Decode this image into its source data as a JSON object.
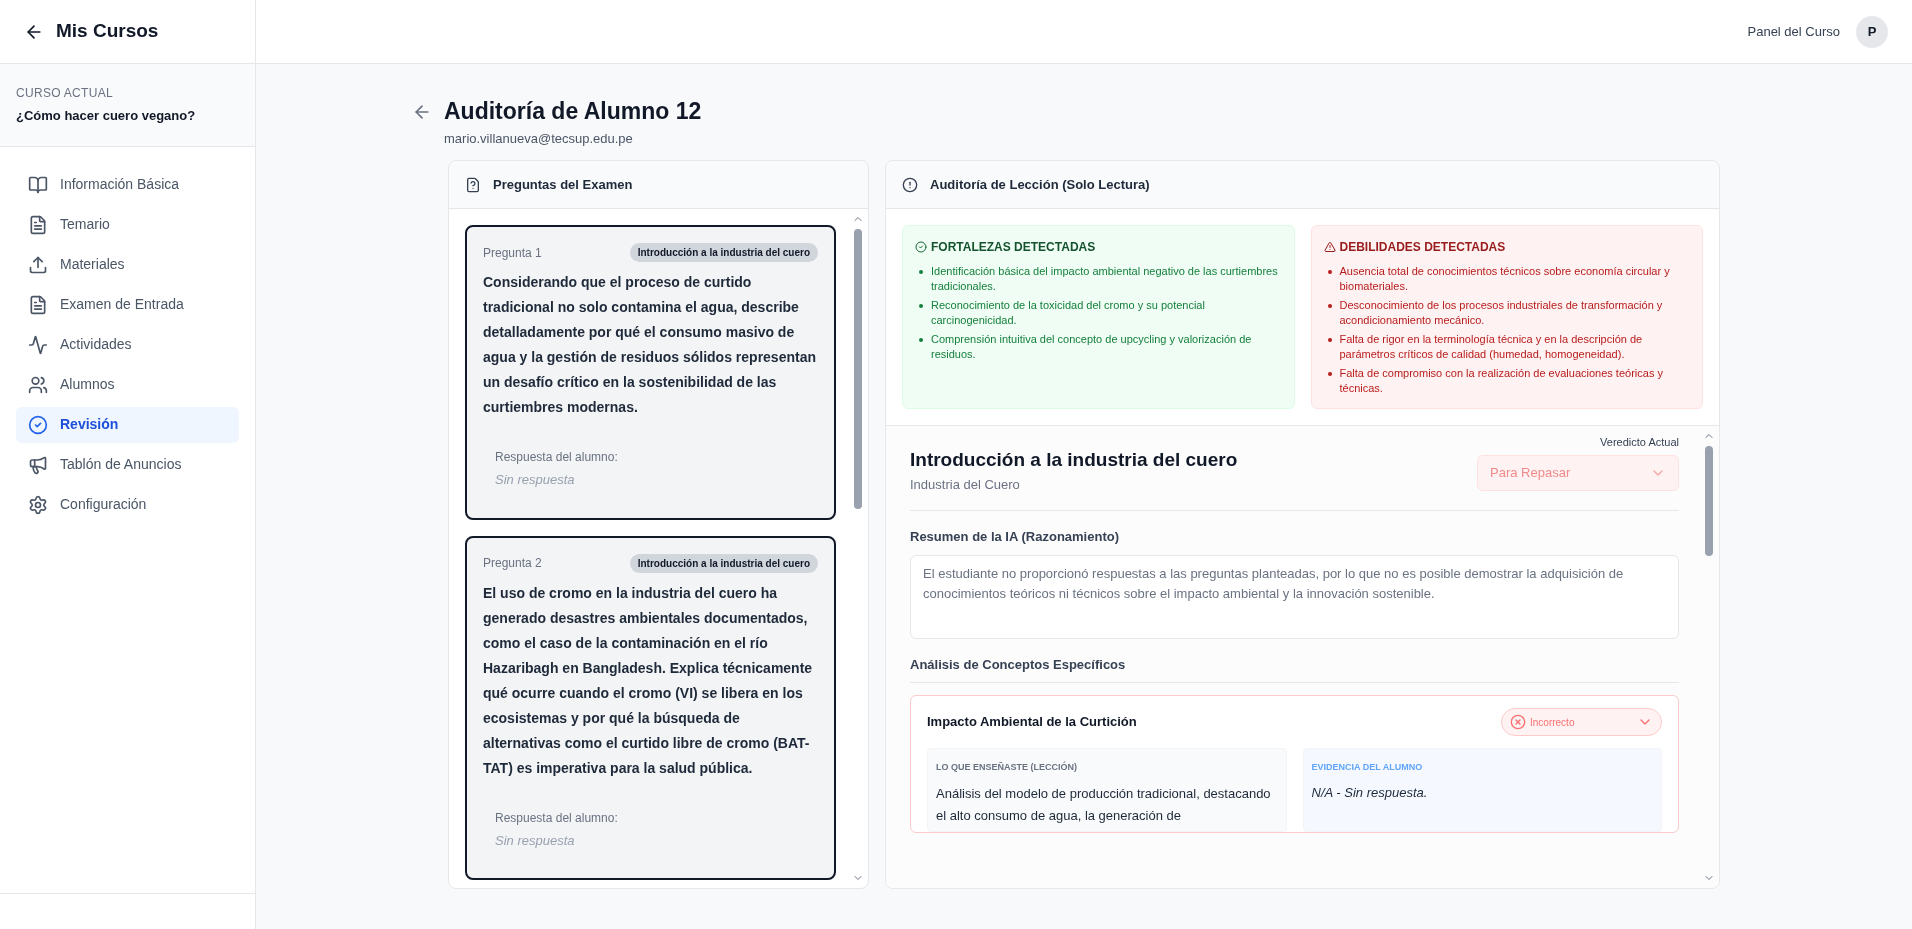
{
  "sidebar": {
    "back_label": "Mis Cursos",
    "course_caption": "CURSO ACTUAL",
    "course_name": "¿Cómo hacer cuero vegano?",
    "items": [
      {
        "label": "Información Básica",
        "kind": "book",
        "selected": false
      },
      {
        "label": "Temario",
        "kind": "file",
        "selected": false
      },
      {
        "label": "Materiales",
        "kind": "upload",
        "selected": false
      },
      {
        "label": "Examen de Entrada",
        "kind": "file",
        "selected": false
      },
      {
        "label": "Actividades",
        "kind": "activity",
        "selected": false
      },
      {
        "label": "Alumnos",
        "kind": "users",
        "selected": false
      },
      {
        "label": "Revisión",
        "kind": "check",
        "selected": true
      },
      {
        "label": "Tablón de Anuncios",
        "kind": "megaphone",
        "selected": false
      },
      {
        "label": "Configuración",
        "kind": "gear",
        "selected": false
      }
    ]
  },
  "topbar": {
    "link": "Panel del Curso",
    "avatar": "P"
  },
  "page": {
    "title": "Auditoría de Alumno 12",
    "email": "mario.villanueva@tecsup.edu.pe"
  },
  "questions_panel": {
    "title": "Preguntas del Examen",
    "questions": [
      {
        "label": "Pregunta 1",
        "tag": "Introducción a la industria del cuero",
        "text": "Considerando que el proceso de curtido tradicional no solo contamina el agua, describe detalladamente por qué el consumo masivo de agua y la gestión de residuos sólidos representan un desafío crítico en la sostenibilidad de las curtiembres modernas.",
        "answer_label": "Respuesta del alumno:",
        "answer": "Sin respuesta"
      },
      {
        "label": "Pregunta 2",
        "tag": "Introducción a la industria del cuero",
        "text": "El uso de cromo en la industria del cuero ha generado desastres ambientales documentados, como el caso de la contaminación en el río Hazaribagh en Bangladesh. Explica técnicamente qué ocurre cuando el cromo (VI) se libera en los ecosistemas y por qué la búsqueda de alternativas como el curtido libre de cromo (BAT-TAT) es imperativa para la salud pública.",
        "answer_label": "Respuesta del alumno:",
        "answer": "Sin respuesta"
      }
    ]
  },
  "audit_panel": {
    "title": "Auditoría de Lección (Solo Lectura)",
    "strengths": {
      "title": "FORTALEZAS DETECTADAS",
      "items": [
        "Identificación básica del impacto ambiental negativo de las curtiembres tradicionales.",
        "Reconocimiento de la toxicidad del cromo y su potencial carcinogenicidad.",
        "Comprensión intuitiva del concepto de upcycling y valorización de residuos."
      ]
    },
    "weaknesses": {
      "title": "DEBILIDADES DETECTADAS",
      "items": [
        "Ausencia total de conocimientos técnicos sobre economía circular y biomateriales.",
        "Desconocimiento de los procesos industriales de transformación y acondicionamiento mecánico.",
        "Falta de rigor en la terminología técnica y en la descripción de parámetros críticos de calidad (humedad, homogeneidad).",
        "Falta de compromiso con la realización de evaluaciones teóricas y técnicas."
      ]
    },
    "lesson": {
      "title": "Introducción a la industria del cuero",
      "subtitle": "Industria del Cuero",
      "verdict_label": "Veredicto Actual",
      "verdict": "Para Repasar",
      "summary_title": "Resumen de la IA (Razonamiento)",
      "summary": "El estudiante no proporcionó respuestas a las preguntas planteadas, por lo que no es posible demostrar la adquisición de conocimientos teóricos ni técnicos sobre el impacto ambiental y la innovación sostenible.",
      "concepts_title": "Análisis de Conceptos Específicos",
      "concepts": [
        {
          "title": "Impacto Ambiental de la Curtición",
          "status": "Incorrecto",
          "correct": false,
          "taught_label": "LO QUE ENSEÑASTE (LECCIÓN)",
          "taught": "Análisis del modelo de producción tradicional, destacando el alto consumo de agua, la generación de",
          "evidence_label": "EVIDENCIA DEL ALUMNO",
          "evidence": "N/A - Sin respuesta."
        }
      ]
    }
  }
}
